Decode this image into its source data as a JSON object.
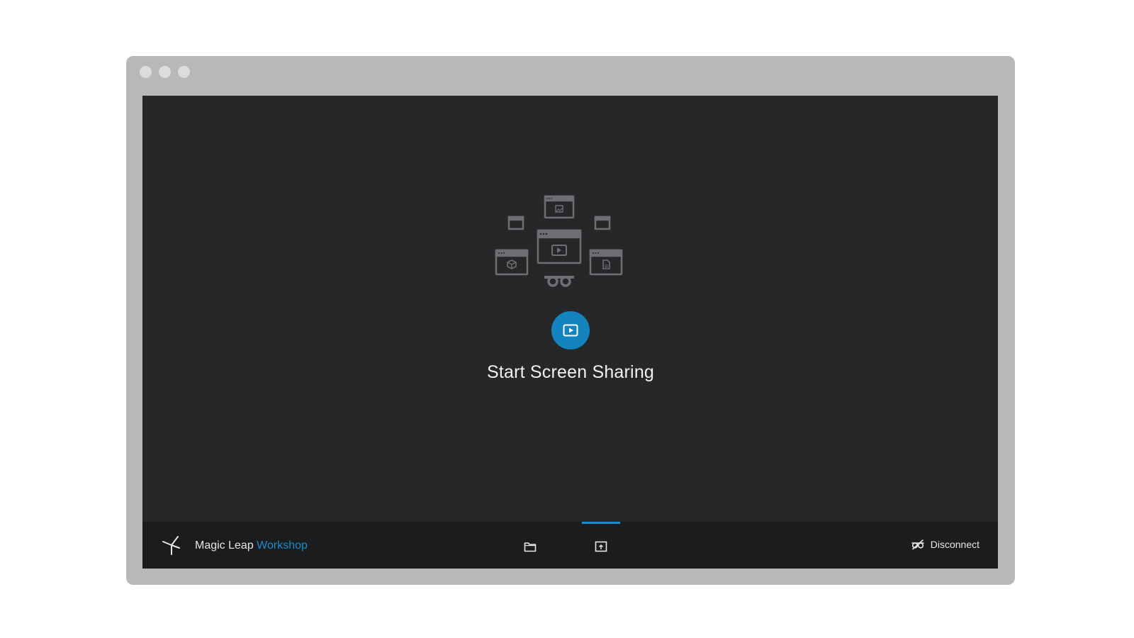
{
  "main": {
    "start_sharing_label": "Start Screen Sharing"
  },
  "footer": {
    "brand_primary": "Magic Leap",
    "brand_secondary": "Workshop",
    "nav": [
      {
        "icon": "folder-icon",
        "active": false
      },
      {
        "icon": "share-screen-icon",
        "active": true
      }
    ],
    "disconnect_label": "Disconnect"
  },
  "colors": {
    "accent": "#1384be",
    "screen_background": "#262729",
    "bar_background": "#1b1c1e",
    "frame": "#b8b8b8"
  }
}
